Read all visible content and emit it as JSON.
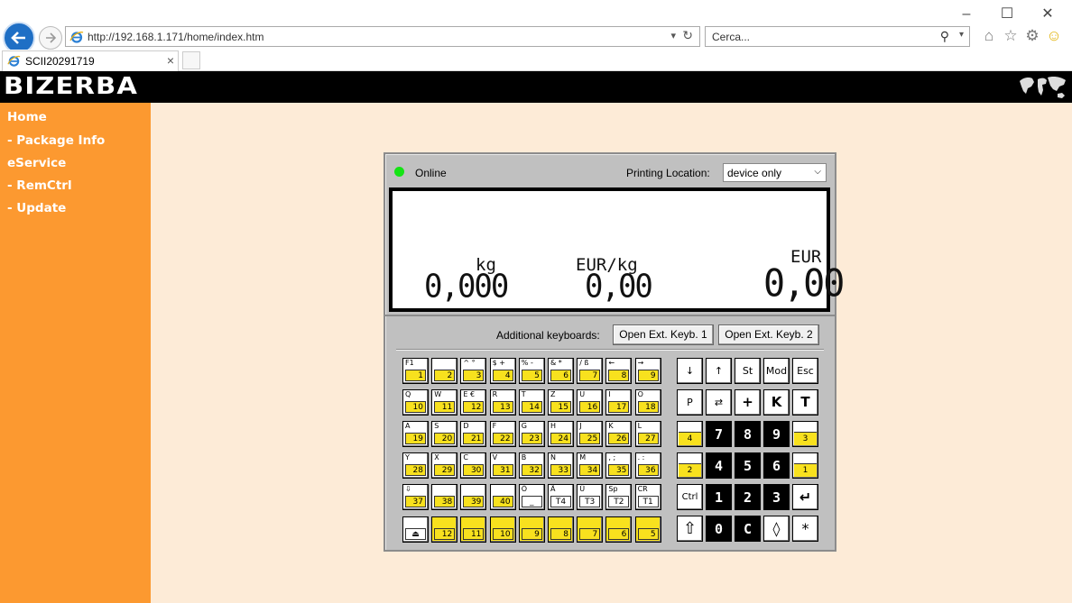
{
  "browser": {
    "url": "http://192.168.1.171/home/index.htm",
    "search_placeholder": "Cerca...",
    "tab_title": "SCII20291719"
  },
  "brand": "BIZERBA",
  "nav": [
    {
      "label": "Home"
    },
    {
      "label": "- Package Info"
    },
    {
      "label": "eService"
    },
    {
      "label": "- RemCtrl"
    },
    {
      "label": "- Update"
    }
  ],
  "device": {
    "status": "Online",
    "status_color": "#14e414",
    "printing_location_label": "Printing Location:",
    "printing_location_value": "device only",
    "display": {
      "weight_unit": "kg",
      "weight_value": "0,000",
      "price_unit": "EUR/kg",
      "price_value": "0,00",
      "total_unit": "EUR",
      "total_value": "0,00"
    },
    "additional_keyboards_label": "Additional keyboards:",
    "ext_keyb_1": "Open  Ext. Keyb. 1",
    "ext_keyb_2": "Open  Ext. Keyb. 2",
    "alpha_keys": [
      [
        {
          "t": "F1",
          "n": "1"
        },
        {
          "t": "",
          "n": "2"
        },
        {
          "t": "^  °",
          "n": "3"
        },
        {
          "t": "$ +",
          "n": "4"
        },
        {
          "t": "% -",
          "n": "5"
        },
        {
          "t": "& *",
          "n": "6"
        },
        {
          "t": "/ ß",
          "n": "7"
        },
        {
          "t": "←",
          "n": "8"
        },
        {
          "t": "→",
          "n": "9"
        }
      ],
      [
        {
          "t": "Q",
          "n": "10"
        },
        {
          "t": "W",
          "n": "11"
        },
        {
          "t": "E  €",
          "n": "12"
        },
        {
          "t": "R",
          "n": "13"
        },
        {
          "t": "T",
          "n": "14"
        },
        {
          "t": "Z",
          "n": "15"
        },
        {
          "t": "U",
          "n": "16"
        },
        {
          "t": "I",
          "n": "17"
        },
        {
          "t": "O",
          "n": "18"
        }
      ],
      [
        {
          "t": "A",
          "n": "19"
        },
        {
          "t": "S",
          "n": "20"
        },
        {
          "t": "D",
          "n": "21"
        },
        {
          "t": "F",
          "n": "22"
        },
        {
          "t": "G",
          "n": "23"
        },
        {
          "t": "H",
          "n": "24"
        },
        {
          "t": "J",
          "n": "25"
        },
        {
          "t": "K",
          "n": "26"
        },
        {
          "t": "L",
          "n": "27"
        }
      ],
      [
        {
          "t": "Y",
          "n": "28"
        },
        {
          "t": "X",
          "n": "29"
        },
        {
          "t": "C",
          "n": "30"
        },
        {
          "t": "V",
          "n": "31"
        },
        {
          "t": "B",
          "n": "32"
        },
        {
          "t": "N",
          "n": "33"
        },
        {
          "t": "M",
          "n": "34"
        },
        {
          "t": ",  ;",
          "n": "35"
        },
        {
          "t": ".  :",
          "n": "36"
        }
      ],
      [
        {
          "t": "⇩",
          "n": "37"
        },
        {
          "t": "",
          "n": "38"
        },
        {
          "t": "",
          "n": "39"
        },
        {
          "t": "",
          "n": "40"
        },
        {
          "t": "Ö",
          "n": "_",
          "w": true
        },
        {
          "t": "Ä",
          "n": "T4",
          "w": true
        },
        {
          "t": "Ü",
          "n": "T3",
          "w": true
        },
        {
          "t": "Sp",
          "n": "T2",
          "w": true
        },
        {
          "t": "CR",
          "n": "T1",
          "w": true
        }
      ],
      [
        {
          "t": "",
          "n": "⏏",
          "w": true
        },
        {
          "t": "",
          "n": "12"
        },
        {
          "t": "",
          "n": "11"
        },
        {
          "t": "",
          "n": "10"
        },
        {
          "t": "",
          "n": "9"
        },
        {
          "t": "",
          "n": "8"
        },
        {
          "t": "",
          "n": "7"
        },
        {
          "t": "",
          "n": "6"
        },
        {
          "t": "",
          "n": "5"
        }
      ]
    ],
    "func_keys": {
      "row1": [
        "↓",
        "↑",
        "St",
        "Mod",
        "Esc"
      ],
      "row2": [
        "P",
        "⇄",
        "+",
        "K",
        "T"
      ],
      "numpad": [
        [
          "7",
          "8",
          "9"
        ],
        [
          "4",
          "5",
          "6"
        ],
        [
          "1",
          "2",
          "3"
        ],
        [
          "0",
          "C"
        ]
      ],
      "side_left": [
        "4",
        "2"
      ],
      "side_right": [
        "3",
        "1"
      ],
      "ctrl": "Ctrl",
      "enter": "↵",
      "shift": "⇧",
      "diamond": "◊",
      "star": "*"
    }
  }
}
